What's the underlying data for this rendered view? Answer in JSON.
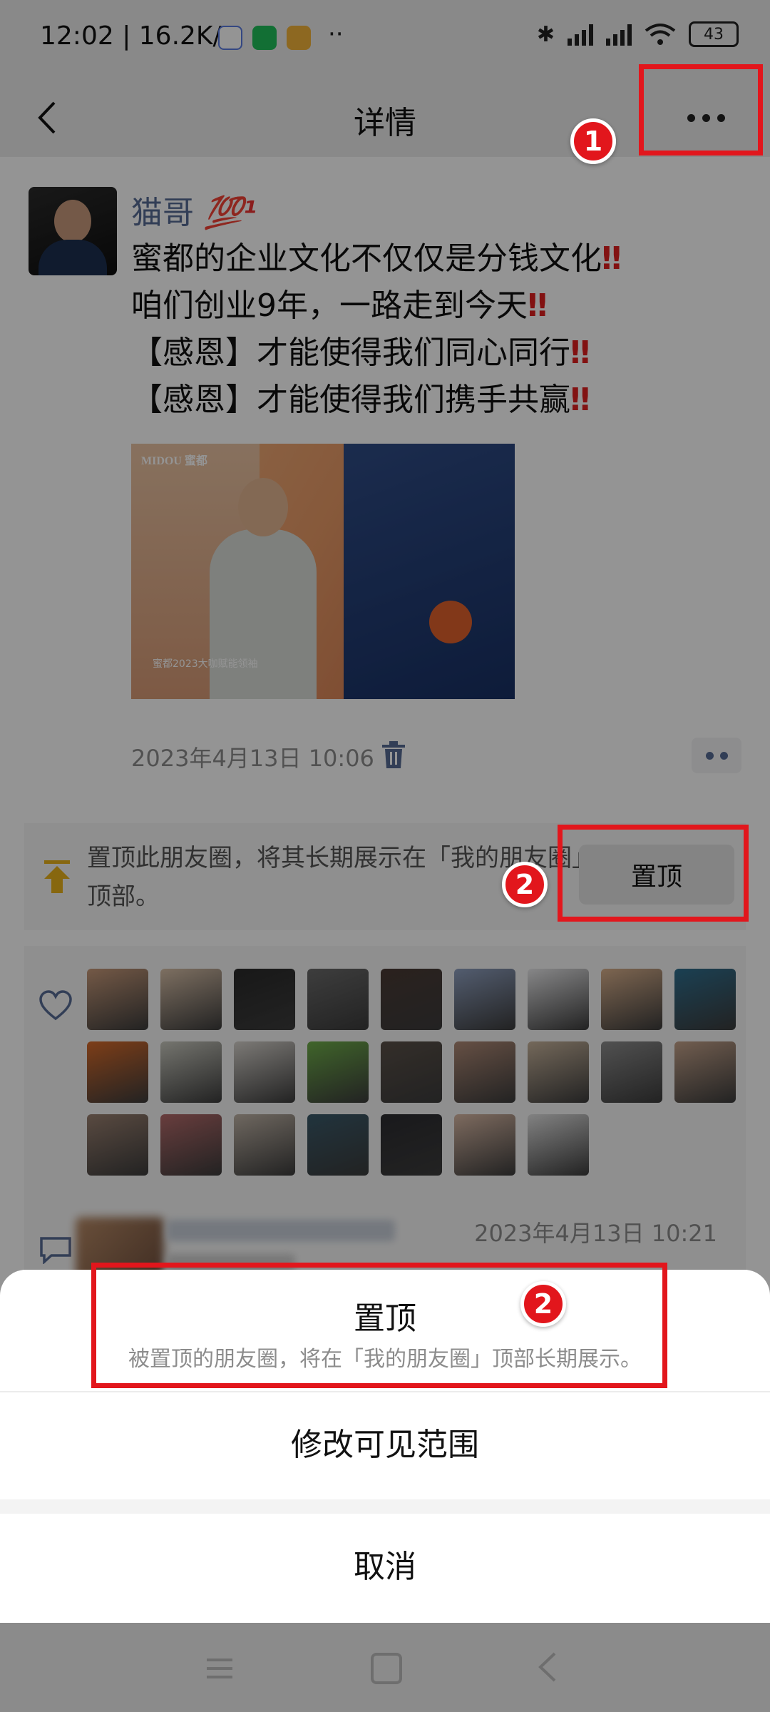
{
  "status_bar": {
    "time": "12:02",
    "speed": "16.2K/s",
    "overflow": "··",
    "battery": "43"
  },
  "nav": {
    "title": "详情"
  },
  "post": {
    "author": "猫哥",
    "badge": "💯¹",
    "lines": [
      "蜜都的企业文化不仅仅是分钱文化",
      "咱们创业9年，一路走到今天",
      "【感恩】才能使得我们同心同行",
      "【感恩】才能使得我们携手共赢"
    ],
    "bang": "‼",
    "photo_text_top": "MIDOU 蜜都",
    "photo_text_bottom": "蜜都2023大咖赋能领袖",
    "timestamp": "2023年4月13日 10:06"
  },
  "pin_tip": {
    "text": "置顶此朋友圈，将其长期展示在「我的朋友圈」顶部。",
    "button": "置顶"
  },
  "comments": {
    "time": "2023年4月13日 10:21"
  },
  "sheet": {
    "pin_title": "置顶",
    "pin_subtitle": "被置顶的朋友圈，将在「我的朋友圈」顶部长期展示。",
    "edit_visibility": "修改可见范围",
    "cancel": "取消"
  },
  "annotations": {
    "step1": "1",
    "step2": "2"
  },
  "colors": {
    "link": "#576b95",
    "highlight": "#e2161c"
  },
  "like_avatar_colors": [
    "#c89a7a",
    "#d8c0a8",
    "#2a2a2a",
    "#6a6a6a",
    "#4a3a34",
    "#8fa0c0",
    "#e8e8ea",
    "#d9b08c",
    "#2f6f8f",
    "#d86b2a",
    "#c9c9bf",
    "#d6d2cc",
    "#6fae4a",
    "#5a5048",
    "#b08a76",
    "#c8b49c",
    "#8c8c8c",
    "#c4a28a",
    "#9a8070",
    "#b46a6a",
    "#bfb3a6",
    "#3a5a6a",
    "#2c2c30",
    "#d8b8a4",
    "#e0e0e0"
  ]
}
